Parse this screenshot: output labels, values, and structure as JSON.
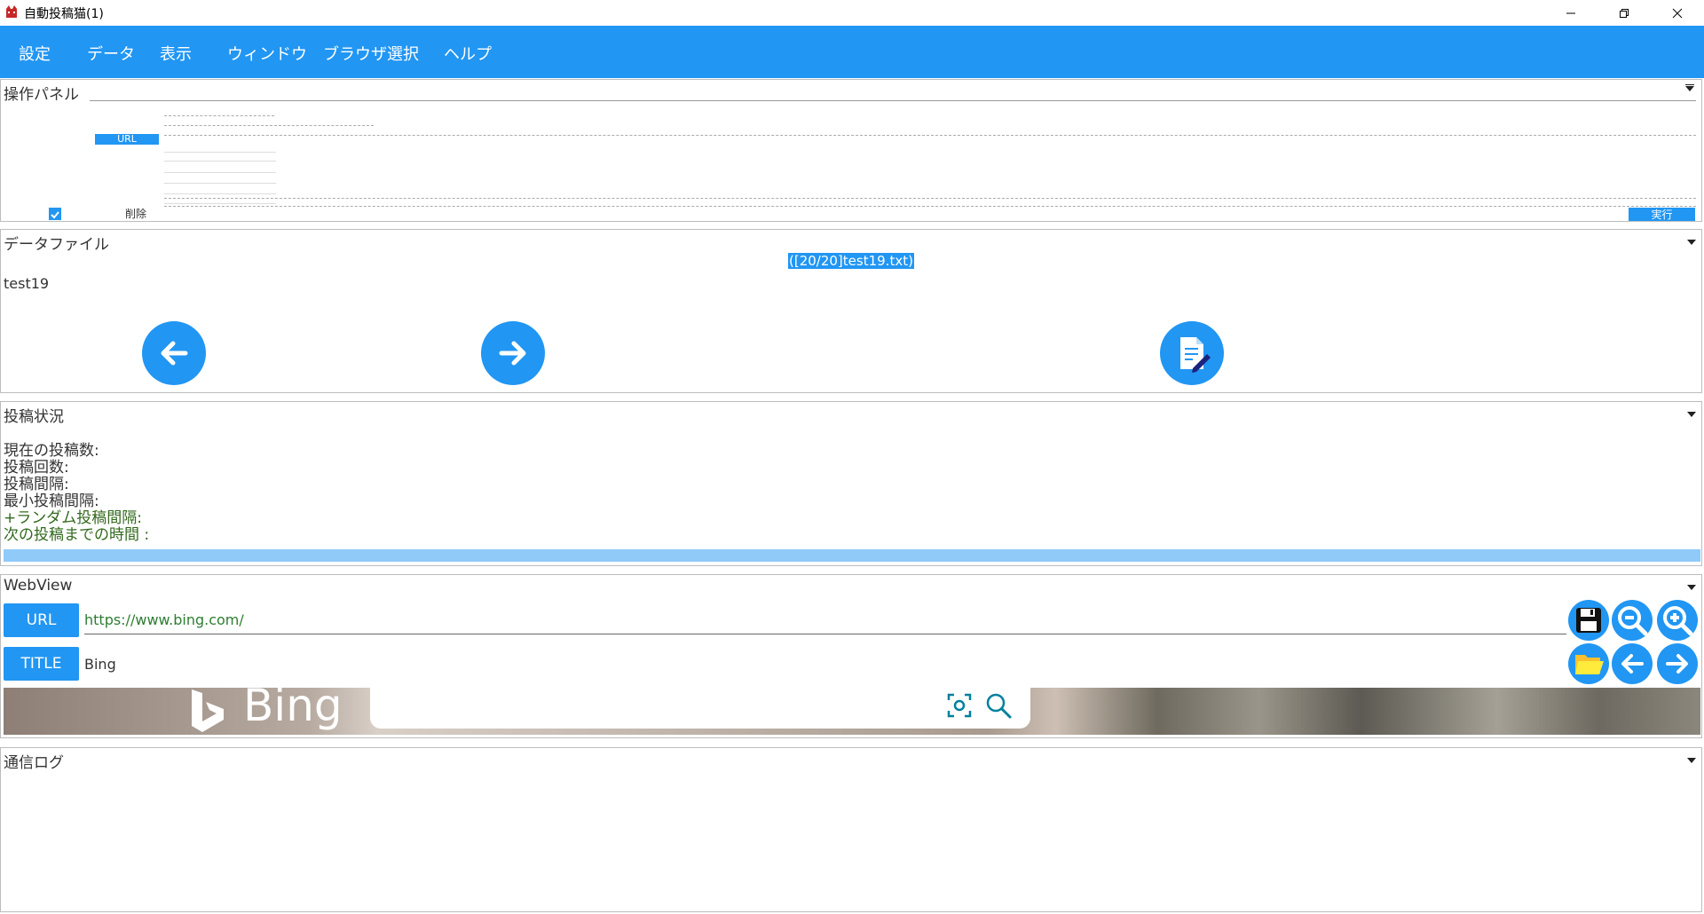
{
  "window": {
    "title": "自動投稿猫(1)"
  },
  "menu": [
    "設定",
    "データ",
    "表示",
    "ウィンドウ",
    "ブラウザ選択",
    "ヘルプ"
  ],
  "operation_panel": {
    "title": "操作パネル",
    "url_button": "URL",
    "delete_label": "削除",
    "run_button": "実行"
  },
  "data_file": {
    "title": "データファイル",
    "file_info": "([20/20]test19.txt)",
    "content": "test19"
  },
  "post_status": {
    "title": "投稿状況",
    "lines": [
      "現在の投稿数:",
      "投稿回数:",
      "投稿間隔:",
      "最小投稿間隔:",
      "+ランダム投稿間隔:",
      "次の投稿までの時間 :"
    ],
    "progress": 1.0
  },
  "webview": {
    "title": "WebView",
    "url_button": "URL",
    "url_value": "https://www.bing.com/",
    "title_button": "TITLE",
    "page_title": "Bing",
    "bing_logo_text": "Bing"
  },
  "comm_log": {
    "title": "通信ログ"
  },
  "colors": {
    "accent": "#2196f3",
    "progress": "#90caf9",
    "folder": "#ffeb3b"
  }
}
